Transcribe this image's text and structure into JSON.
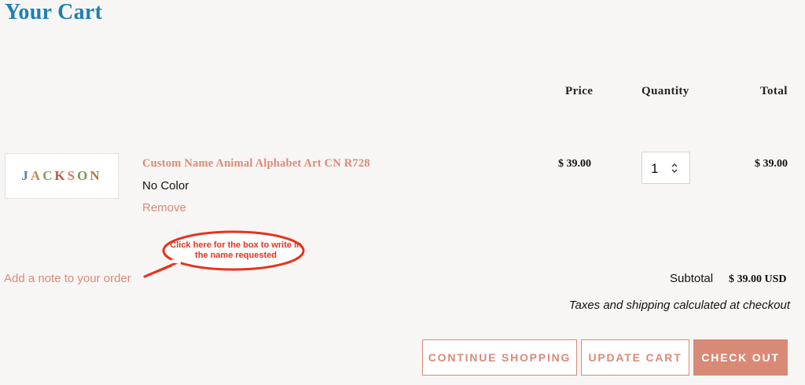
{
  "page": {
    "title": "Your Cart"
  },
  "table": {
    "headers": {
      "price": "Price",
      "quantity": "Quantity",
      "total": "Total"
    }
  },
  "item": {
    "thumbnail_word": [
      "J",
      "A",
      "C",
      "K",
      "S",
      "O",
      "N"
    ],
    "title": "Custom Name Animal Alphabet Art CN R728",
    "variant": "No Color",
    "remove_label": "Remove",
    "price": "$ 39.00",
    "quantity": "1",
    "total": "$ 39.00"
  },
  "note": {
    "link_label": "Add a note to your order",
    "callout_text": "Click here for the box to write in the name requested",
    "callout_color": "#e8321e"
  },
  "summary": {
    "subtotal_label": "Subtotal",
    "subtotal_value": "$ 39.00 USD",
    "tax_note": "Taxes and shipping calculated at checkout"
  },
  "buttons": {
    "continue": "CONTINUE SHOPPING",
    "update": "UPDATE CART",
    "checkout": "CHECK OUT"
  },
  "colors": {
    "title": "#1e7fb3",
    "accent": "#d98a76",
    "background": "#f8f6f4"
  }
}
